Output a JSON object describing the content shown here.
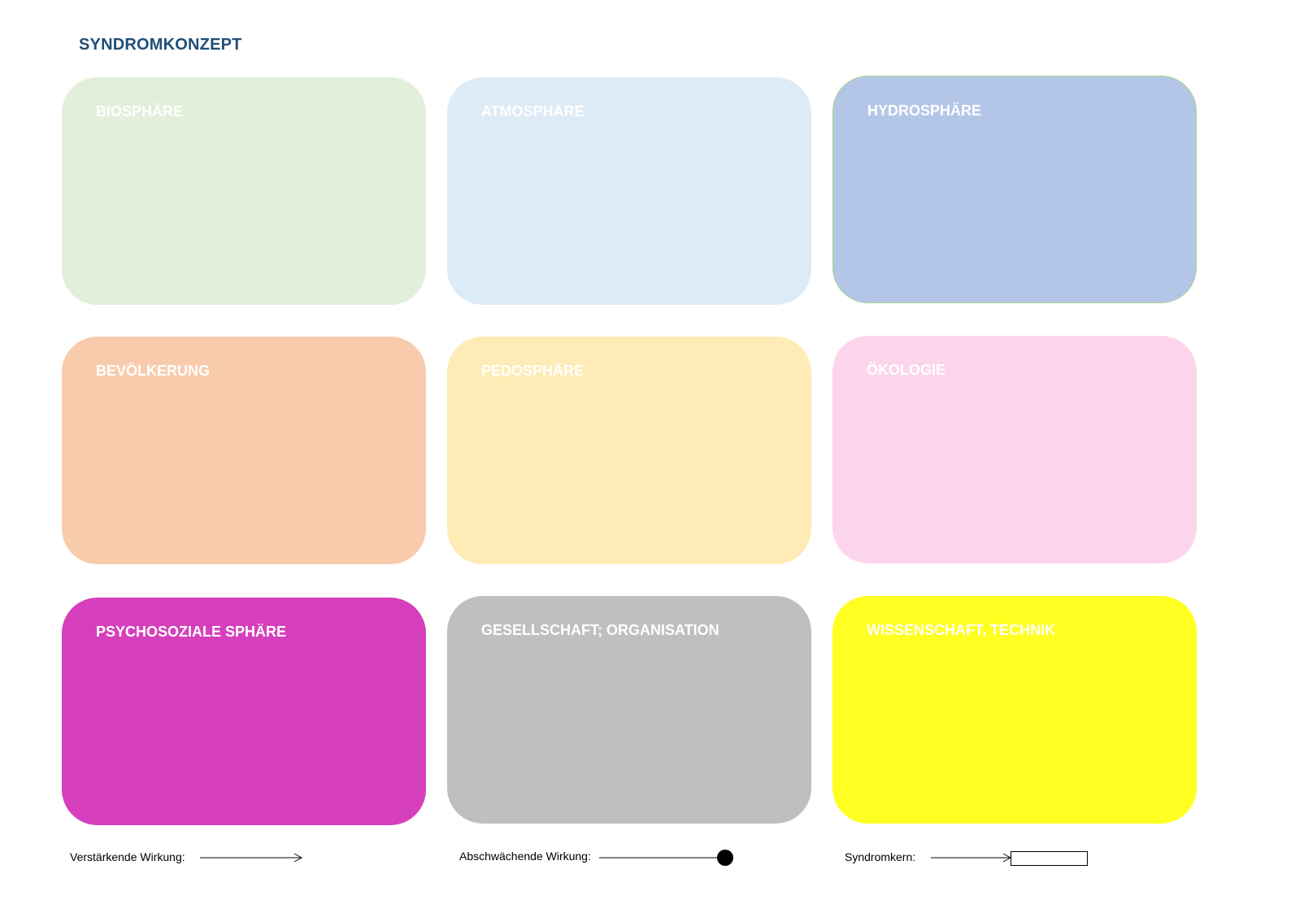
{
  "title": "SYNDROMKONZEPT",
  "boxes": [
    {
      "label": "BIOSPHÄRE",
      "color": "#e2efda"
    },
    {
      "label": "ATMOSPHÄRE",
      "color": "#ddebf7"
    },
    {
      "label": "HYDROSPHÄRE",
      "color": "#b4c6e7",
      "border": "#a9d18e"
    },
    {
      "label": "BEVÖLKERUNG",
      "color": "#f8cbad"
    },
    {
      "label": "PEDOSPHÄRE",
      "color": "#ffebb5"
    },
    {
      "label": "ÖKOLOGIE",
      "color": "#fcd5ec"
    },
    {
      "label": "PSYCHOSOZIALE SPHÄRE",
      "color": "#d63fbb"
    },
    {
      "label": "GESELLSCHAFT; ORGANISATION",
      "color": "#bfbfbf"
    },
    {
      "label": "WISSENSCHAFT, TECHNIK",
      "color": "#ffff22"
    }
  ],
  "legend": {
    "amplifying": "Verstärkende Wirkung:",
    "weakening": "Abschwächende Wirkung:",
    "core": "Syndromkern:"
  }
}
